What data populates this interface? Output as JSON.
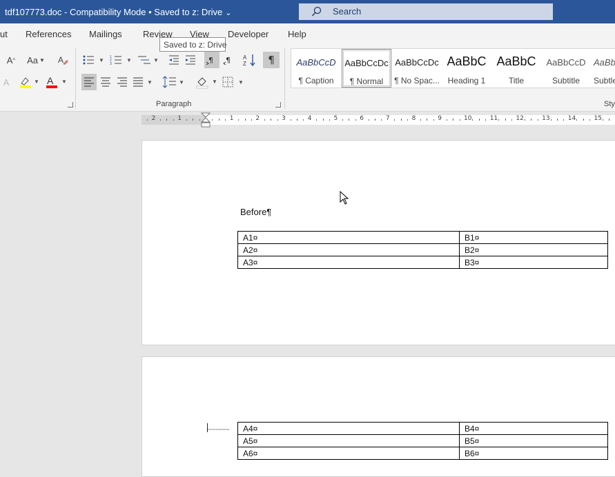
{
  "titlebar": {
    "title": "tdf107773.doc  -  Compatibility Mode • Saved to z: Drive",
    "chevron": "⌄"
  },
  "search": {
    "label": "Search"
  },
  "tabs": [
    "ut",
    "References",
    "Mailings",
    "Review",
    "View",
    "Developer",
    "Help"
  ],
  "tooltip": "Saved to z: Drive",
  "ribbon": {
    "font_size_up": "A",
    "change_case": "Aa",
    "highlight_color": "#ffff00",
    "font_color": "#ff0000",
    "paragraph_group": "Paragraph",
    "styles_group": "Sty"
  },
  "styles": [
    {
      "preview": "AaBbCcD",
      "name": "¶ Caption"
    },
    {
      "preview": "AaBbCcDc",
      "name": "¶ Normal"
    },
    {
      "preview": "AaBbCcDc",
      "name": "¶ No Spac..."
    },
    {
      "preview": "AaBbC",
      "name": "Heading 1"
    },
    {
      "preview": "AaBbC",
      "name": "Title"
    },
    {
      "preview": "AaBbCcD",
      "name": "Subtitle"
    },
    {
      "preview": "AaBbC",
      "name": "Subtle"
    }
  ],
  "ruler": {
    "left_numbers": [
      "2",
      "1"
    ],
    "right_numbers": [
      "1",
      "2",
      "3",
      "4",
      "5",
      "6",
      "7",
      "8",
      "9",
      "10",
      "11",
      "12",
      "13",
      "14",
      "15"
    ]
  },
  "document": {
    "before_text": "Before¶",
    "table1": [
      [
        "A1¤",
        "B1¤"
      ],
      [
        "A2¤",
        "B2¤"
      ],
      [
        "A3¤",
        "B3¤"
      ]
    ],
    "table2": [
      [
        "A4¤",
        "B4¤"
      ],
      [
        "A5¤",
        "B5¤"
      ],
      [
        "A6¤",
        "B6¤"
      ]
    ]
  }
}
